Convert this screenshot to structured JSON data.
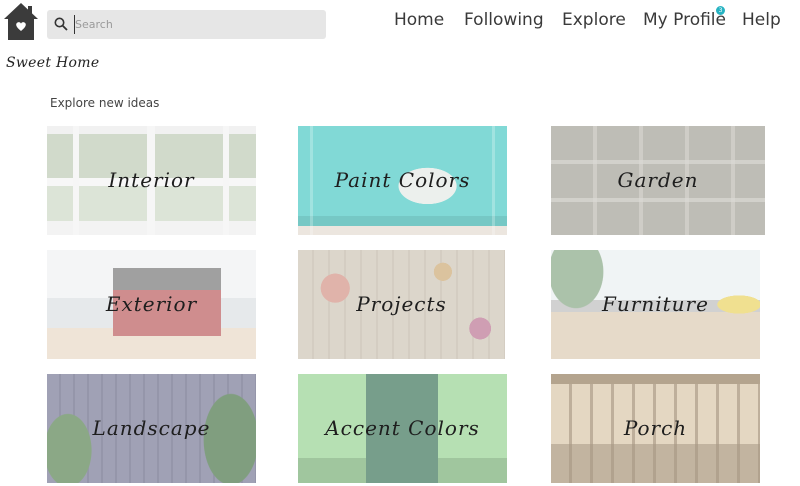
{
  "header": {
    "search_placeholder": "Search",
    "badge_count": "3",
    "nav": [
      {
        "label": "Home"
      },
      {
        "label": "Following"
      },
      {
        "label": "Explore"
      },
      {
        "label": "My Profile"
      },
      {
        "label": "Help"
      }
    ]
  },
  "brand": "Sweet Home",
  "section_title": "Explore new ideas",
  "tiles": [
    {
      "label": "Interior"
    },
    {
      "label": "Paint Colors"
    },
    {
      "label": "Garden"
    },
    {
      "label": "Exterior"
    },
    {
      "label": "Projects"
    },
    {
      "label": "Furniture"
    },
    {
      "label": "Landscape"
    },
    {
      "label": "Accent Colors"
    },
    {
      "label": "Porch"
    }
  ],
  "colors": {
    "accent": "#27b3c2",
    "paint_tile": "#6cd3cf",
    "search_bg": "#e6e6e6"
  }
}
